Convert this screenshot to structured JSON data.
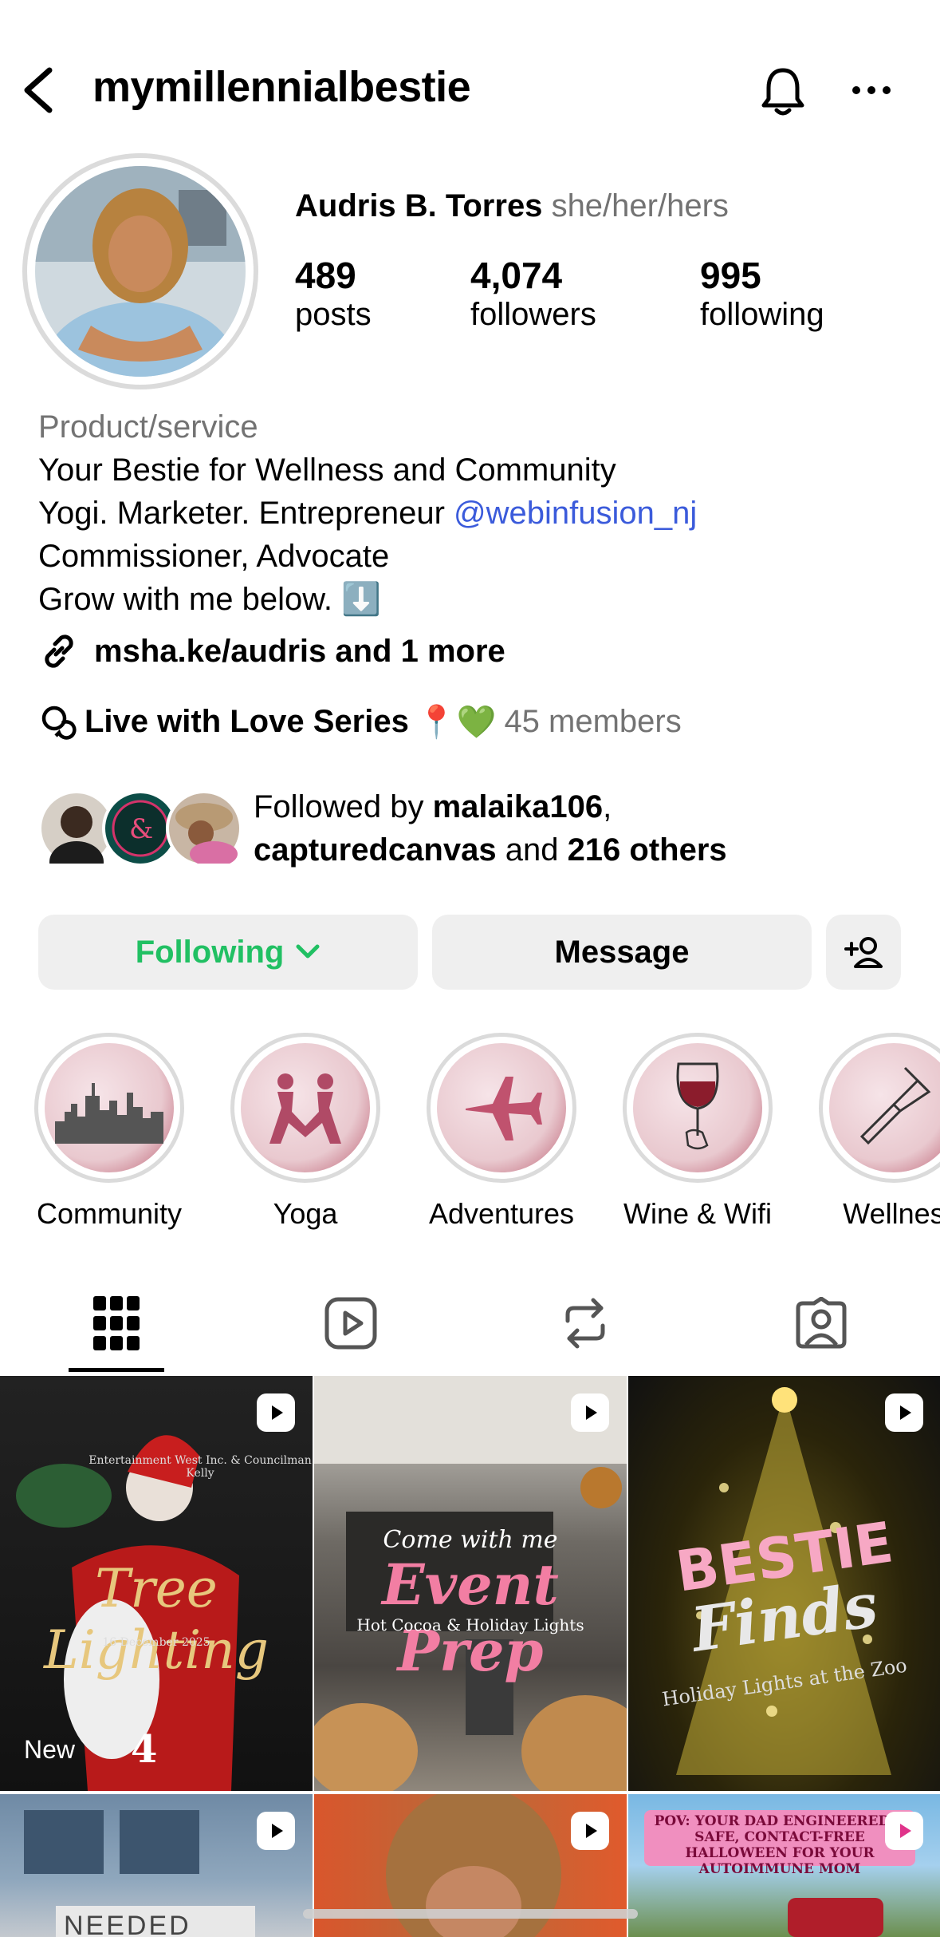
{
  "header": {
    "username": "mymillennialbestie"
  },
  "profile": {
    "name": "Audris B. Torres",
    "pronouns": "she/her/hers",
    "stats": [
      {
        "value": "489",
        "label": "posts"
      },
      {
        "value": "4,074",
        "label": "followers"
      },
      {
        "value": "995",
        "label": "following"
      }
    ],
    "category": "Product/service",
    "bio_line1": "Your Bestie for Wellness and Community",
    "bio_line2_text": "Yogi. Marketer. Entrepreneur ",
    "bio_line2_mention": "@webinfusion_nj",
    "bio_line3": "Commissioner, Advocate",
    "bio_line4": "Grow with me below. ⬇️",
    "link": "msha.ke/audris and 1 more",
    "channel_name": "Live with Love Series",
    "channel_emojis": "📍💚",
    "channel_members": "45 members",
    "followed_prefix": "Followed by ",
    "followed_user1": "malaika106",
    "followed_comma": ",",
    "followed_user2": "capturedcanvas",
    "followed_and": " and ",
    "followed_others": "216 others"
  },
  "actions": {
    "following": "Following",
    "message": "Message"
  },
  "highlights": [
    {
      "label": "Community",
      "icon": "skyline-icon"
    },
    {
      "label": "Yoga",
      "icon": "yoga-icon"
    },
    {
      "label": "Adventures",
      "icon": "airplane-icon"
    },
    {
      "label": "Wine & Wifi",
      "icon": "wine-glass-icon"
    },
    {
      "label": "Wellnes",
      "icon": "comb-icon"
    }
  ],
  "tabs": [
    "grid-icon",
    "reels-icon",
    "reposts-icon",
    "tagged-icon"
  ],
  "posts": [
    {
      "title": "Tree Lighting",
      "small": "16 December 2025",
      "top": "Entertainment West Inc. & Councilman Kelly",
      "new_label": "New",
      "number": "4"
    },
    {
      "title": "Event Prep",
      "prefix": "Come with me",
      "small": "Hot Cocoa & Holiday Lights"
    },
    {
      "title": "BESTIE",
      "title2": "Finds",
      "small": "Holiday Lights at the Zoo"
    },
    {
      "title": "NEEDED"
    },
    {
      "title": ""
    },
    {
      "title": "POV: YOUR DAD ENGINEERED A SAFE, CONTACT-FREE HALLOWEEN FOR YOUR AUTOIMMUNE MOM"
    }
  ],
  "colors": {
    "following_green": "#21c063",
    "mention_blue": "#3b5bdb",
    "muted_gray": "#737373",
    "button_bg": "#efefef"
  }
}
